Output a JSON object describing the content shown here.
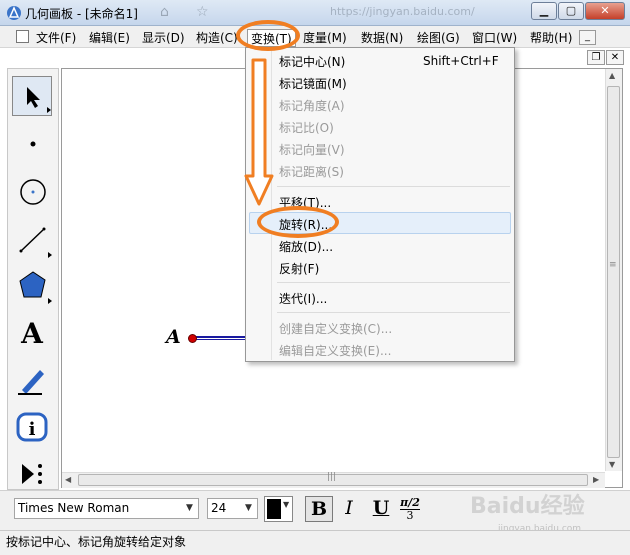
{
  "window": {
    "title": "几何画板 - [未命名1]",
    "url_ghost": "https://jingyan.baidu.com/"
  },
  "menubar": {
    "items": [
      {
        "label": "文件(F)"
      },
      {
        "label": "编辑(E)"
      },
      {
        "label": "显示(D)"
      },
      {
        "label": "构造(C)"
      },
      {
        "label": "变换(T)"
      },
      {
        "label": "度量(M)"
      },
      {
        "label": "数据(N)"
      },
      {
        "label": "绘图(G)"
      },
      {
        "label": "窗口(W)"
      },
      {
        "label": "帮助(H)"
      }
    ]
  },
  "transform_menu": {
    "items": [
      {
        "label": "标记中心(N)",
        "shortcut": "Shift+Ctrl+F",
        "enabled": true
      },
      {
        "label": "标记镜面(M)",
        "enabled": true
      },
      {
        "label": "标记角度(A)",
        "enabled": false
      },
      {
        "label": "标记比(O)",
        "enabled": false
      },
      {
        "label": "标记向量(V)",
        "enabled": false
      },
      {
        "label": "标记距离(S)",
        "enabled": false
      },
      {
        "label": "平移(T)...",
        "enabled": true
      },
      {
        "label": "旋转(R)...",
        "enabled": true,
        "highlighted": true
      },
      {
        "label": "缩放(D)...",
        "enabled": true
      },
      {
        "label": "反射(F)",
        "enabled": true
      },
      {
        "label": "迭代(I)...",
        "enabled": true
      },
      {
        "label": "创建自定义变换(C)...",
        "enabled": false
      },
      {
        "label": "编辑自定义变换(E)...",
        "enabled": false
      }
    ]
  },
  "toolbox": {
    "tools": [
      {
        "icon": "arrow-select-icon"
      },
      {
        "icon": "point-tool-icon"
      },
      {
        "icon": "compass-tool-icon"
      },
      {
        "icon": "line-tool-icon"
      },
      {
        "icon": "polygon-tool-icon"
      },
      {
        "icon": "text-tool-icon",
        "glyph": "A"
      },
      {
        "icon": "marker-tool-icon"
      },
      {
        "icon": "info-tool-icon"
      },
      {
        "icon": "custom-tool-icon"
      }
    ]
  },
  "canvas": {
    "point_label": "A",
    "colors": {
      "point": "#d00000",
      "segment": "#1a1aa0"
    }
  },
  "formatbar": {
    "font_name": "Times New Roman",
    "font_size": "24",
    "bold_label": "B",
    "italic_label": "I",
    "underline_label": "U",
    "math_top": "π/2",
    "math_bottom": "3",
    "text_color": "#000000"
  },
  "statusbar": {
    "text": "按标记中心、标记角旋转给定对象"
  },
  "watermark": {
    "text": "Baidu经验",
    "sub": "jingyan.baidu.com"
  },
  "annotation_color": "#f07e22"
}
